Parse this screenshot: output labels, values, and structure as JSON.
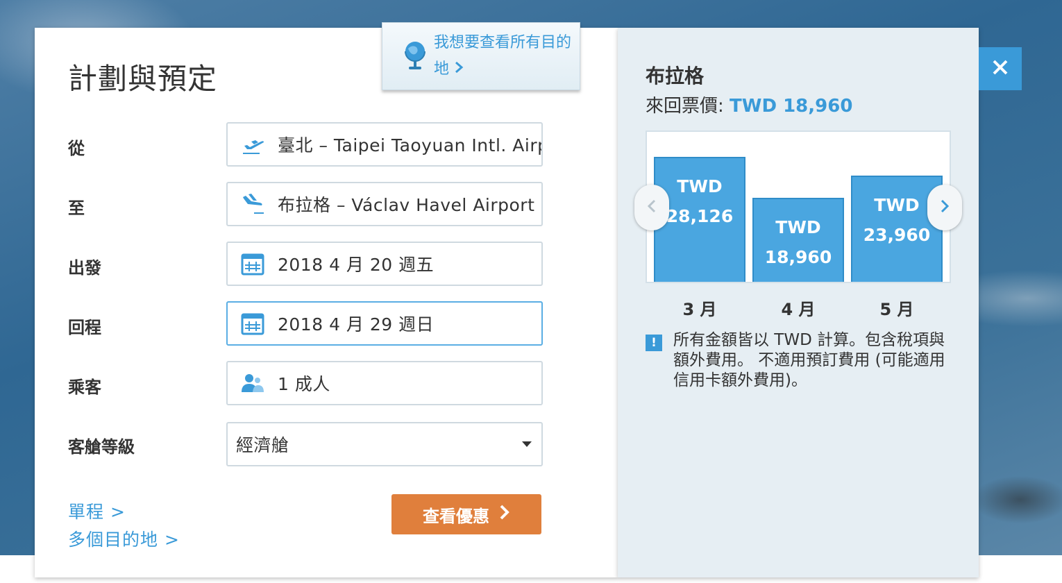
{
  "form": {
    "title": "計劃與預定",
    "explore_tab_label": "我想要查看所有目的地",
    "fields": {
      "from": {
        "label": "從",
        "value": "臺北 – Taipei Taoyuan Intl. Airport",
        "icon": "plane-takeoff-icon"
      },
      "to": {
        "label": "至",
        "value": "布拉格 – Václav Havel Airport",
        "icon": "plane-landing-icon"
      },
      "depart": {
        "label": "出發",
        "value": "2018 4 月 20 週五",
        "icon": "calendar-icon"
      },
      "return": {
        "label": "回程",
        "value": "2018 4 月 29 週日",
        "icon": "calendar-icon"
      },
      "passengers": {
        "label": "乘客",
        "value": "1 成人",
        "icon": "users-icon"
      },
      "cabin": {
        "label": "客艙等級",
        "value": "經濟艙"
      }
    },
    "links": {
      "one_way": "單程 >",
      "multi_city": "多個目的地 >"
    },
    "cta_label": "查看優惠"
  },
  "sidebar": {
    "destination": "布拉格",
    "price_label": "來回票價:",
    "price_value": "TWD 18,960",
    "chart_data": {
      "type": "bar",
      "categories": [
        "3 月",
        "4 月",
        "5 月"
      ],
      "values": [
        28126,
        18960,
        23960
      ],
      "value_labels": [
        [
          "TWD",
          "28,126"
        ],
        [
          "TWD",
          "18,960"
        ],
        [
          "TWD",
          "23,960"
        ]
      ],
      "grid": false
    },
    "note": "所有金額皆以 TWD 計算。包含稅項與額外費用。 不適用預訂費用 (可能適用信用卡額外費用)。"
  },
  "colors": {
    "accent": "#3a9ad8",
    "cta": "#e07f3c",
    "sidebar_bg": "#e6eef3"
  }
}
